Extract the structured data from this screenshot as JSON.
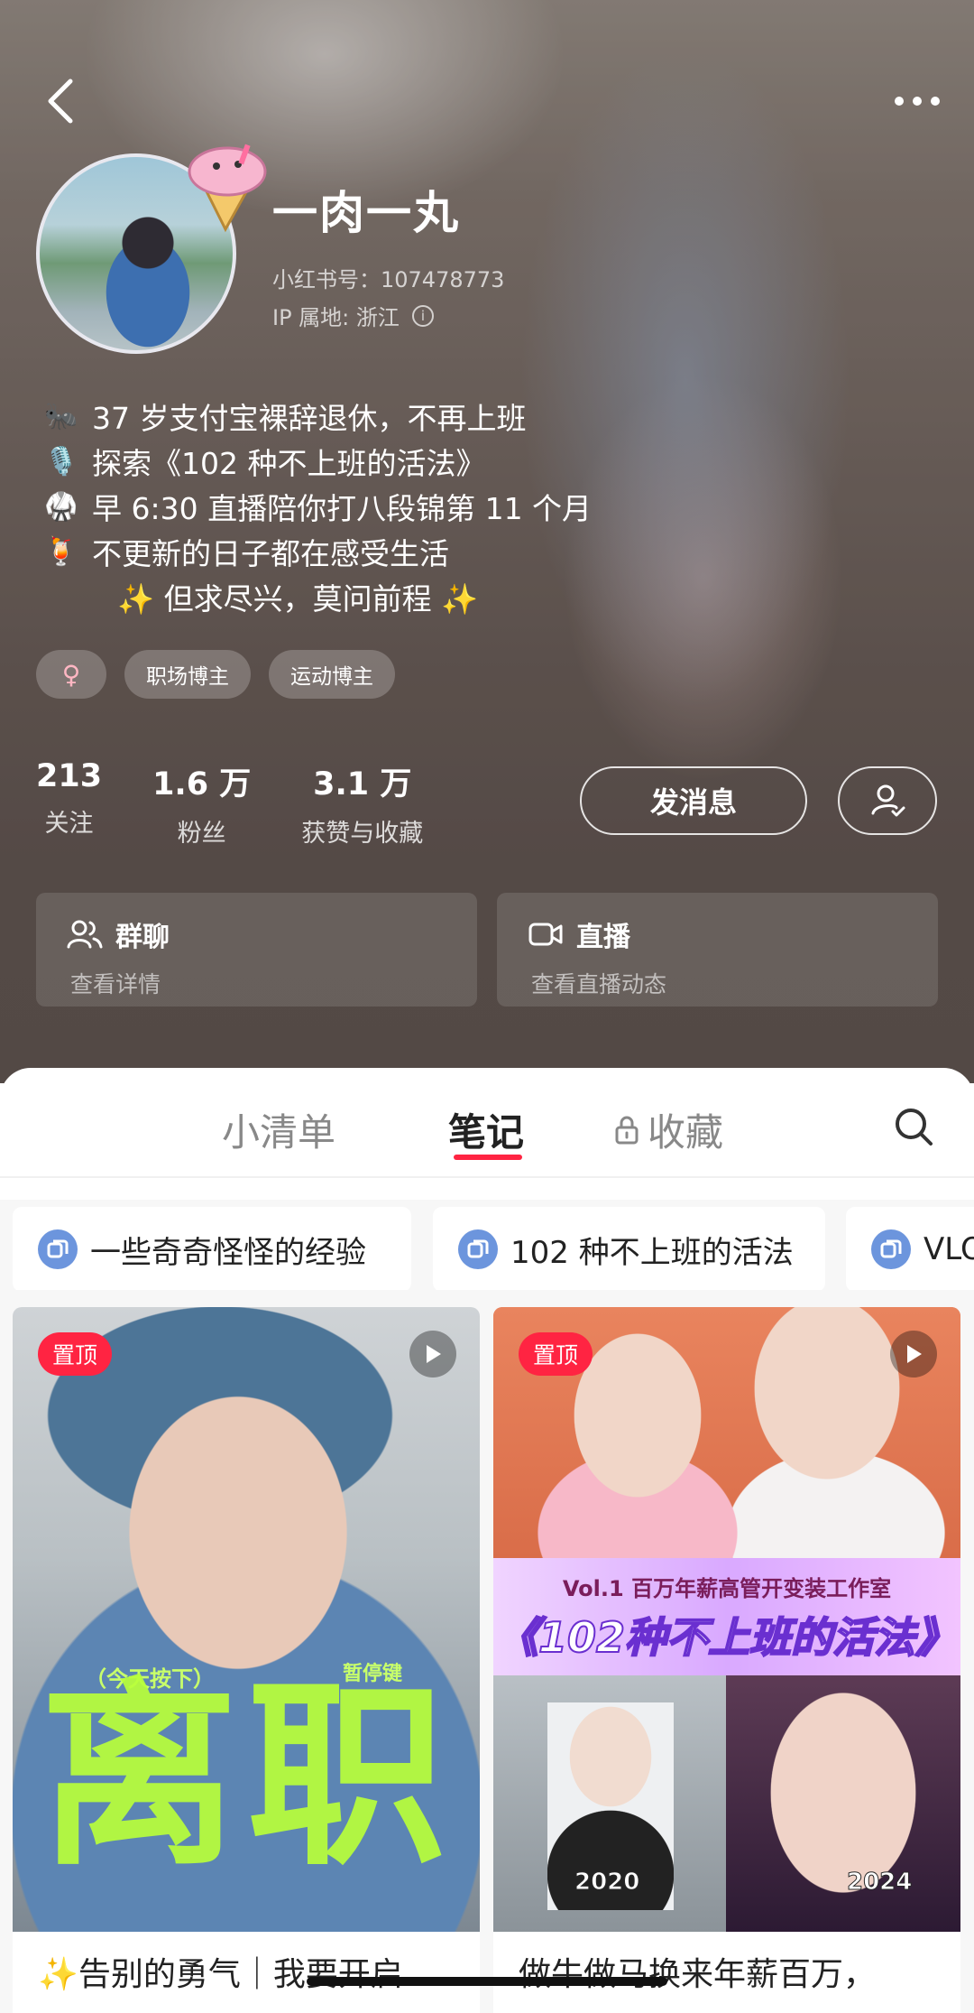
{
  "header": {
    "back_label": "",
    "more_label": "• • •"
  },
  "profile": {
    "username": "一肉一丸",
    "red_id": "小红书号：107478773",
    "ip_location": "IP 属地: 浙江",
    "bio": [
      {
        "icon": "🐜",
        "text": "37 岁支付宝裸辞退休，不再上班"
      },
      {
        "icon": "🎙️",
        "text": "探索《102 种不上班的活法》"
      },
      {
        "icon": "🥋",
        "text": "早 6:30 直播陪你打八段锦第 11 个月"
      },
      {
        "icon": "🍹",
        "text": "不更新的日子都在感受生活"
      },
      {
        "icon": "",
        "text": "✨ 但求尽兴，莫问前程 ✨"
      }
    ],
    "tags": {
      "gender": "♀",
      "tag1": "职场博主",
      "tag2": "运动博主"
    },
    "stats": [
      {
        "value": "213",
        "label": "关注"
      },
      {
        "value": "1.6 万",
        "label": "粉丝"
      },
      {
        "value": "3.1 万",
        "label": "获赞与收藏"
      }
    ],
    "message_button": "发消息",
    "group_card": {
      "title": "群聊",
      "subtitle": "查看详情"
    },
    "live_card": {
      "title": "直播",
      "subtitle": "查看直播动态"
    }
  },
  "tabs": {
    "list": "小清单",
    "notes": "笔记",
    "favorites": "收藏"
  },
  "collections": [
    "一些奇奇怪怪的经验",
    "102 种不上班的活法",
    "VLOG"
  ],
  "notes": [
    {
      "pin_label": "置顶",
      "cover_text_a": "（今天按下）",
      "cover_text_b": "暂停键",
      "cover_big": "离职",
      "title": "✨告别的勇气｜我要开启"
    },
    {
      "pin_label": "置顶",
      "banner_small": "Vol.1  百万年薪高管开变装工作室",
      "banner_big": "《102种不上班的活法》",
      "year_left": "2020",
      "year_right": "2024",
      "title": "做牛做马换来年薪百万，"
    }
  ],
  "colors": {
    "accent": "#ff2442",
    "collection_icon": "#6c95dd"
  }
}
